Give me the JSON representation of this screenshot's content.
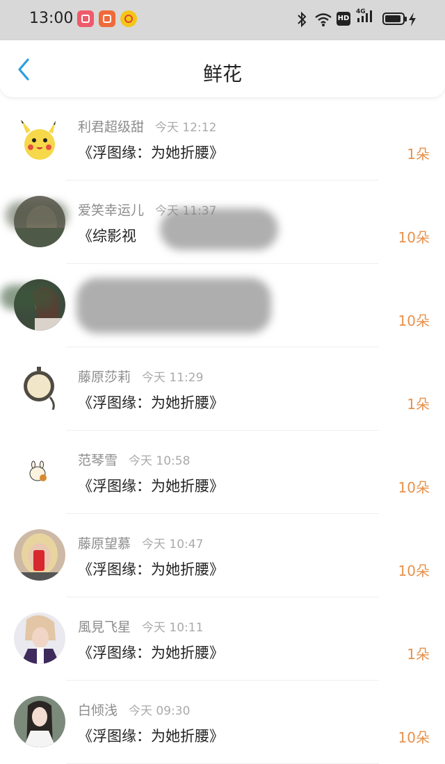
{
  "status_bar": {
    "time": "13:00",
    "network": "4G",
    "hd": "HD",
    "icons": [
      "app-icon-1",
      "app-icon-2",
      "weibo-icon",
      "bluetooth-icon",
      "wifi-icon",
      "hd-icon",
      "signal-icon",
      "battery-icon"
    ]
  },
  "header": {
    "title": "鲜花",
    "back_icon": "chevron-left-icon"
  },
  "colors": {
    "accent": "#e8914a",
    "back_arrow": "#2a9ee0",
    "status_bar_bg": "#d8d8d8"
  },
  "items": [
    {
      "name": "利君超级甜",
      "time": "今天 12:12",
      "book": "《浮图缘：为她折腰》",
      "flowers": "1朵"
    },
    {
      "name": "爱笑幸运儿",
      "time": "今天 11:37",
      "book": "《综影视",
      "flowers": "10朵"
    },
    {
      "name": "",
      "time": "",
      "book": "",
      "flowers": "10朵"
    },
    {
      "name": "藤原莎莉",
      "time": "今天 11:29",
      "book": "《浮图缘：为她折腰》",
      "flowers": "1朵"
    },
    {
      "name": "范琴雪",
      "time": "今天 10:58",
      "book": "《浮图缘：为她折腰》",
      "flowers": "10朵"
    },
    {
      "name": "藤原望慕",
      "time": "今天 10:47",
      "book": "《浮图缘：为她折腰》",
      "flowers": "10朵"
    },
    {
      "name": "風見飞星",
      "time": "今天 10:11",
      "book": "《浮图缘：为她折腰》",
      "flowers": "1朵"
    },
    {
      "name": "白倾浅",
      "time": "今天 09:30",
      "book": "《浮图缘：为她折腰》",
      "flowers": "10朵"
    }
  ]
}
